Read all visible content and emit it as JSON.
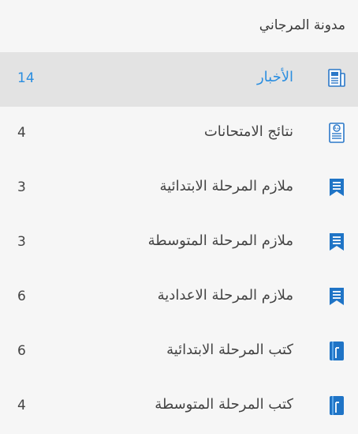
{
  "header": {
    "title": "مدونة المرجاني"
  },
  "items": [
    {
      "label": "الأخبار",
      "count": "14",
      "icon": "newspaper-icon",
      "active": true
    },
    {
      "label": "نتائج الامتحانات",
      "count": "4",
      "icon": "exam-results-icon",
      "active": false
    },
    {
      "label": "ملازم المرحلة الابتدائية",
      "count": "3",
      "icon": "bookmark-icon",
      "active": false
    },
    {
      "label": "ملازم المرحلة المتوسطة",
      "count": "3",
      "icon": "bookmark-icon",
      "active": false
    },
    {
      "label": "ملازم المرحلة الاعدادية",
      "count": "6",
      "icon": "bookmark-icon",
      "active": false
    },
    {
      "label": "كتب المرحلة الابتدائية",
      "count": "6",
      "icon": "book-icon",
      "active": false
    },
    {
      "label": "كتب المرحلة المتوسطة",
      "count": "4",
      "icon": "book-icon",
      "active": false
    }
  ],
  "colors": {
    "accent": "#2b8ee0",
    "active_bg": "#e3e3e3",
    "bg": "#f6f6f6"
  }
}
